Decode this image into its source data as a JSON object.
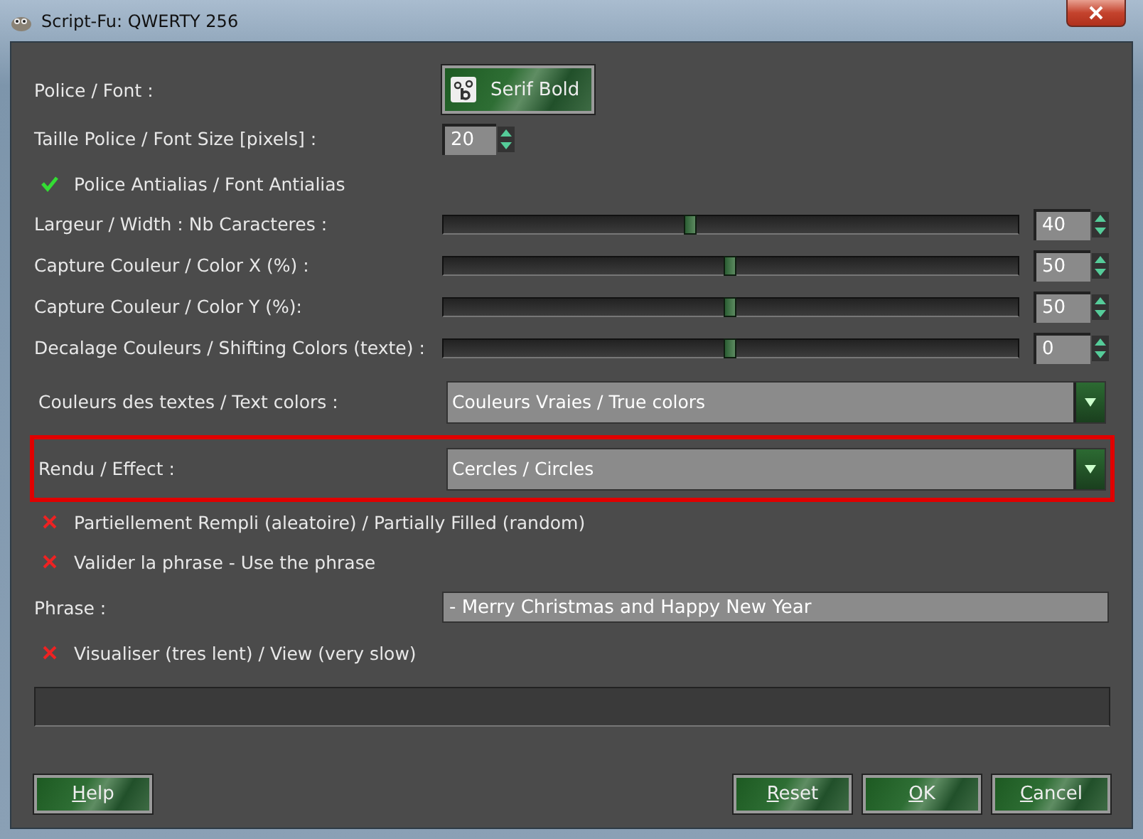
{
  "window": {
    "title": "Script-Fu: QWERTY 256"
  },
  "rows": [
    {
      "kind": "font",
      "label": "Police / Font :",
      "value": "Serif Bold"
    },
    {
      "kind": "spin",
      "label": "Taille Police / Font Size [pixels] :",
      "value": "20"
    },
    {
      "kind": "check",
      "label": "Police Antialias / Font Antialias",
      "checked": true
    },
    {
      "kind": "slider",
      "label": "Largeur / Width : Nb Caracteres :",
      "level": 0.43,
      "value": "40"
    },
    {
      "kind": "slider",
      "label": "Capture Couleur / Color X (%) :",
      "level": 0.5,
      "value": "50"
    },
    {
      "kind": "slider",
      "label": "Capture Couleur / Color Y (%):",
      "level": 0.5,
      "value": "50"
    },
    {
      "kind": "slider",
      "label": "Decalage Couleurs / Shifting Colors (texte) :",
      "level": 0.5,
      "value": "0"
    },
    {
      "kind": "combo",
      "label": "Couleurs des textes / Text colors :",
      "value": "Couleurs Vraies / True colors",
      "highlighted": false
    },
    {
      "kind": "combo",
      "label": "Rendu / Effect :",
      "value": "Cercles / Circles",
      "highlighted": true
    },
    {
      "kind": "check",
      "label": "Partiellement Rempli (aleatoire) / Partially Filled (random)",
      "checked": false
    },
    {
      "kind": "check",
      "label": "Valider la phrase - Use the phrase",
      "checked": false
    },
    {
      "kind": "entry",
      "label": "Phrase :",
      "value": "- Merry Christmas and Happy New Year"
    },
    {
      "kind": "check",
      "label": "Visualiser (tres lent) / View (very slow)",
      "checked": false
    },
    {
      "kind": "progress"
    }
  ],
  "buttons_left": [
    {
      "label": "Help"
    }
  ],
  "buttons_right": [
    {
      "label": "Reset"
    },
    {
      "label": "OK"
    },
    {
      "label": "Cancel"
    }
  ]
}
